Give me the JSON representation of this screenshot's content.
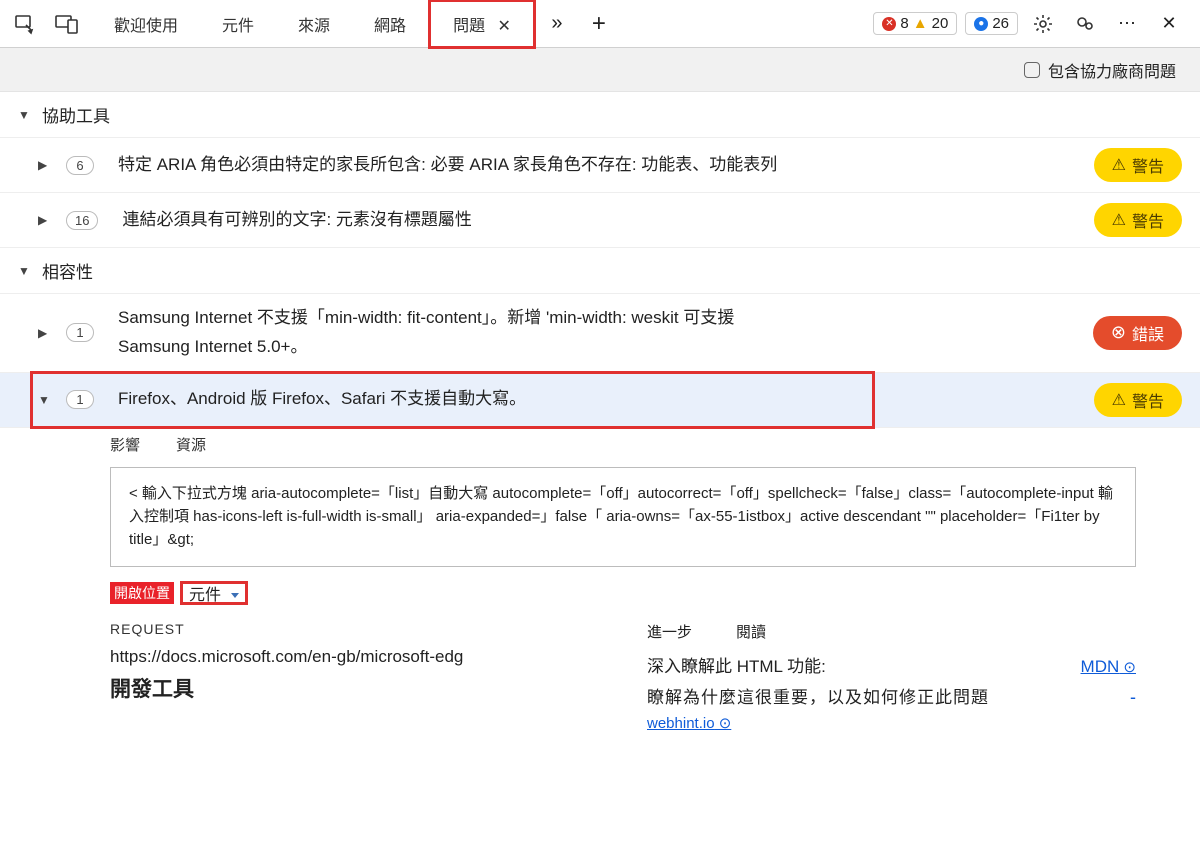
{
  "toolbar": {
    "tabs": [
      "歡迎使用",
      "元件",
      "來源",
      "網路",
      "問題"
    ],
    "active_tab": "問題",
    "errors": "8",
    "warnings": "20",
    "info": "26"
  },
  "filter": {
    "thirdparty_label": "包含協力廠商問題"
  },
  "groups": {
    "accessibility": {
      "title": "協助工具",
      "issues": [
        {
          "count": "6",
          "text": "特定 ARIA 角色必須由特定的家長所包含: 必要 ARIA 家長角色不存在: 功能表、功能表列",
          "severity": "warn",
          "badge": "警告"
        },
        {
          "count": "16",
          "text": "連結必須具有可辨別的文字: 元素沒有標題屬性",
          "severity": "warn",
          "badge": "警告"
        }
      ]
    },
    "compatibility": {
      "title": "相容性",
      "issues": [
        {
          "count": "1",
          "text": "Samsung Internet 不支援「min-width: fit-content」。新增 'min-width:  weskit 可支援 Samsung Internet 5.0+。",
          "severity": "err",
          "badge": "錯誤"
        },
        {
          "count": "1",
          "text": "Firefox、Android 版 Firefox、Safari 不支援自動大寫。",
          "severity": "warn",
          "badge": "警告",
          "selected": true
        }
      ]
    }
  },
  "detail": {
    "tab_affected": "影響",
    "tab_resources": "資源",
    "code": "< 輸入下拉式方塊 aria-autocomplete=「list」自動大寫 autocomplete=「off」autocorrect=「off」spellcheck=「false」class=「autocomplete-input 輸入控制項 has-icons-left is-full-width is-small」 aria-expanded=」false「 aria-owns=「ax-55-1istbox」active descendant                                 \"\"    placeholder=「Fi1ter by title」&gt;",
    "openin_label": "開啟位置",
    "openin_value": "元件",
    "request_h": "REQUEST",
    "request_url": "https://docs.microsoft.com/en-gb/microsoft-edg",
    "request_tool": "開發工具",
    "further_h": "進一步",
    "read_h": "閱讀",
    "further1a": "深入瞭解此 HTML 功能:",
    "further1b": "MDN",
    "further2": "瞭解為什麼這很重要，以及如何修正此問題",
    "further3": "webhint.io"
  }
}
